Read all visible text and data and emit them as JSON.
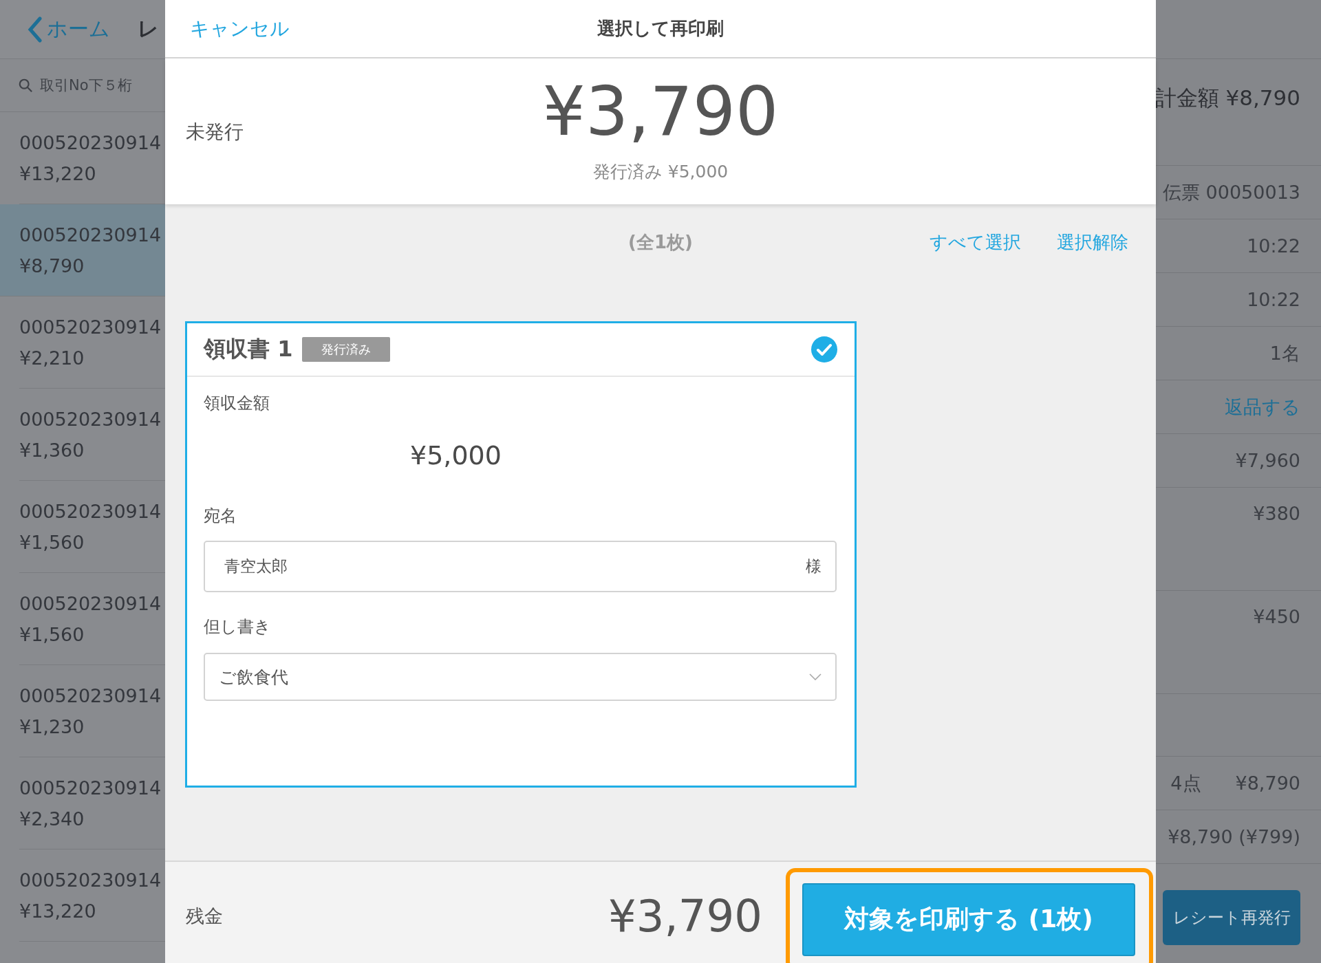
{
  "background": {
    "back_button": "ホーム",
    "title": "レ",
    "search": {
      "placeholder": "取引No下５桁"
    },
    "transactions": [
      {
        "number": "000520230914",
        "amount": "¥13,220",
        "selected": false
      },
      {
        "number": "000520230914",
        "amount": "¥8,790",
        "selected": true
      },
      {
        "number": "000520230914",
        "amount": "¥2,210",
        "selected": false
      },
      {
        "number": "000520230914",
        "amount": "¥1,360",
        "selected": false
      },
      {
        "number": "000520230914",
        "amount": "¥1,560",
        "selected": false
      },
      {
        "number": "000520230914",
        "amount": "¥1,560",
        "selected": false
      },
      {
        "number": "000520230914",
        "amount": "¥1,230",
        "selected": false
      },
      {
        "number": "000520230914",
        "amount": "¥2,340",
        "selected": false
      },
      {
        "number": "000520230914",
        "amount": "¥13,220",
        "selected": false
      }
    ],
    "detail": {
      "total": "計金額 ¥8,790",
      "rows": [
        {
          "kind": "text",
          "value": "伝票 00050013"
        },
        {
          "kind": "text",
          "value": "10:22"
        },
        {
          "kind": "text",
          "value": "10:22"
        },
        {
          "kind": "text",
          "value": "1名"
        },
        {
          "kind": "link",
          "value": "返品する"
        },
        {
          "kind": "text",
          "value": "¥7,960"
        },
        {
          "kind": "item",
          "value": "¥380"
        },
        {
          "kind": "item",
          "value": "¥450"
        },
        {
          "kind": "blank"
        },
        {
          "kind": "pair",
          "label": "4点",
          "value": "¥8,790"
        },
        {
          "kind": "text",
          "value": "¥8,790 (¥799)"
        }
      ],
      "button": "レシート再発行"
    }
  },
  "modal": {
    "cancel": "キャンセル",
    "title": "選択して再印刷",
    "status": "未発行",
    "amount": "¥3,790",
    "issued": "発行済み ¥5,000",
    "count": "(全1枚)",
    "select_all": "すべて選択",
    "deselect": "選択解除",
    "receipts": [
      {
        "title": "領収書 1",
        "badge": "発行済み",
        "selected": true,
        "amount_label": "領収金額",
        "amount": "¥5,000",
        "name_label": "宛名",
        "name": "青空太郎",
        "honorific": "様",
        "note_label": "但し書き",
        "note": "ご飲食代"
      }
    ],
    "footer": {
      "label": "残金",
      "amount": "¥3,790",
      "button": "対象を印刷する (1枚)"
    }
  }
}
